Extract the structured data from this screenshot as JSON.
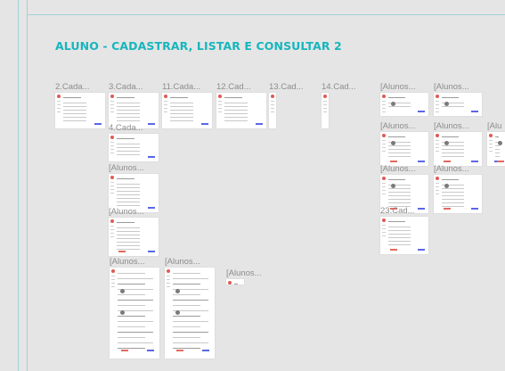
{
  "section": {
    "title": "ALUNO - CADASTRAR, LISTAR E CONSULTAR 2"
  },
  "frames": [
    {
      "label": "2.Cada..."
    },
    {
      "label": "3.Cada..."
    },
    {
      "label": "11.Cada..."
    },
    {
      "label": "12.Cad..."
    },
    {
      "label": "13.Cad..."
    },
    {
      "label": "14.Cad..."
    },
    {
      "label": "[Alunos..."
    },
    {
      "label": "[Alunos..."
    },
    {
      "label": "4.Cada..."
    },
    {
      "label": "[Alunos..."
    },
    {
      "label": "[Alunos..."
    },
    {
      "label": "[Alunos..."
    },
    {
      "label": "[Alu"
    },
    {
      "label": "[Alunos..."
    },
    {
      "label": "[Alunos..."
    },
    {
      "label": "[Alunos..."
    },
    {
      "label": "[Alunos..."
    },
    {
      "label": "23.Cad..."
    },
    {
      "label": "[Alunos..."
    },
    {
      "label": "[Alunos..."
    },
    {
      "label": ""
    }
  ]
}
